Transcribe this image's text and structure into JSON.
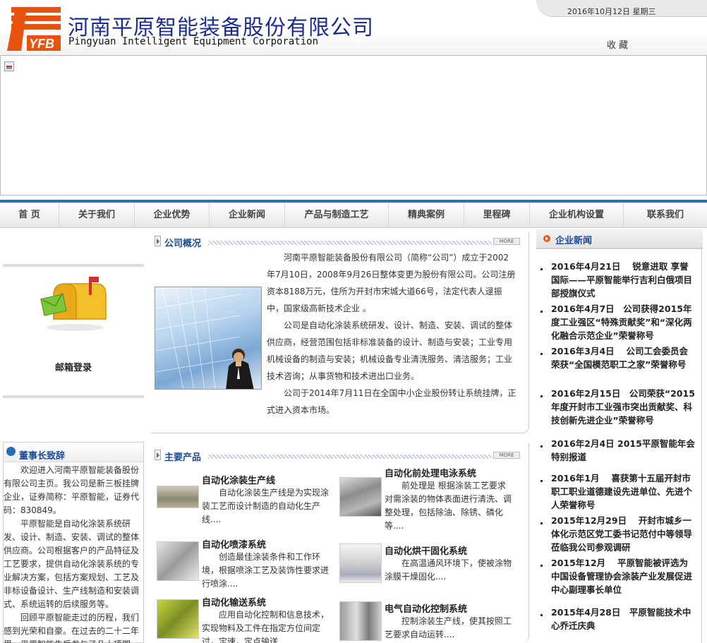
{
  "header": {
    "company_cn": "河南平原智能装备股份有限公司",
    "company_en": "Pingyuan Intelligent Equipment Corporation",
    "logo_text": "YFB",
    "date": "2016年10月12日 星期三",
    "favorite": "收藏"
  },
  "nav": [
    "首 页",
    "关于我们",
    "企业优势",
    "企业新闻",
    "产品与制造工艺",
    "精典案例",
    "里程碑",
    "企业机构设置",
    "联系我们"
  ],
  "mail": {
    "label": "邮箱登录"
  },
  "chairman": {
    "title": "董事长致辞",
    "paragraphs": [
      "欢迎进入河南平原智能装备股份有限公司主页。我公司是新三板挂牌企业，证券简称：平原智能，证券代码：830849。",
      "平原智能是自动化涂装系统研发、设计、制造、安装、调试的整体供应商。公司根据客户的产品特征及工艺要求，提供自动化涂装系统的专业解决方案，包括方案规划、工艺及非标设备设计、生产线制造和安装调式、系统运转的后续服务等。",
      "回顾平原智能走过的历程，我们感到光荣和自豪。在过去的二十二年里，平原智能先后参与了几十项国"
    ]
  },
  "overview": {
    "title": "公司概况",
    "more": "MORE",
    "paragraphs": [
      "河南平原智能装备股份有限公司（简称“公司”）成立于2002年7月10日，2008年9月26日整体变更为股份有限公司。公司注册资本8188万元，住所为开封市宋城大道66号，法定代表人逯振中，国家级高新技术企业 。",
      "公司是自动化涂装系统研发、设计、制造、安装、调试的整体供应商，经营范围包括非标准装备的设计、制造与安装；工业专用机械设备的制造与安装；机械设备专业清洗服务、清洁服务；工业技术咨询；从事货物和技术进出口业务。",
      "公司于2014年7月11日在全国中小企业股份转让系统挂牌，正式进入资本市场。"
    ]
  },
  "products": {
    "title": "主要产品",
    "more": "MORE",
    "items": [
      {
        "title": "自动化涂装生产线",
        "desc": "自动化涂装生产线是为实现涂装工艺而设计制造的自动化生产线...."
      },
      {
        "title": "自动化前处理电泳系统",
        "desc": "前处理是 根据涂装工艺要求对需涂装的物体表面进行清洗、调整处理，包括除油、除锈、磷化等...."
      },
      {
        "title": "自动化喷漆系统",
        "desc": "创造最佳涂装条件和工作环境，根据喷涂工艺及装饰性要求进行喷涂...."
      },
      {
        "title": "自动化烘干固化系统",
        "desc": "在高温通风环境下，使被涂物涂膜干燥固化...."
      },
      {
        "title": "自动化输送系统",
        "desc": "应用自动化控制和信息技术，实现物料及工件在指定方位间定过，定速，定点输送...."
      },
      {
        "title": "电气自动化控制系统",
        "desc": "控制涂装生产线，使其按照工艺要求自动运转...."
      }
    ]
  },
  "news": {
    "title": "企业新闻",
    "items": [
      "2016年4月21日　 锐意进取 享誉国际——平原智能举行吉利白俄项目部授旗仪式",
      "2016年4月7日　公司获得2015年度工业强区“特殊贡献奖”和“深化两化融合示范企业”荣誉称号",
      "2016年3月4日　 公司工会委员会荣获“全国模范职工之家”荣誉称号",
      "2016年2月15日　公司荣获“2015年度开封市工业强市突出贡献奖、科技创新先进企业”荣誉称号",
      "2016年2月4日 2015平原智能年会特别报道",
      "2016年1月　 喜获第十五届开封市职工职业道德建设先进单位、先进个人荣誉称号",
      "2015年12月29日　 开封市城乡一体化示范区党工委书记范付中等领导莅临我公司参观调研",
      "2015年12月　 平原智能被评选为中国设备管理协会涂装产业发展促进中心副理事长单位",
      "2015年4月28日　平原智能技术中心乔迁庆典"
    ]
  }
}
